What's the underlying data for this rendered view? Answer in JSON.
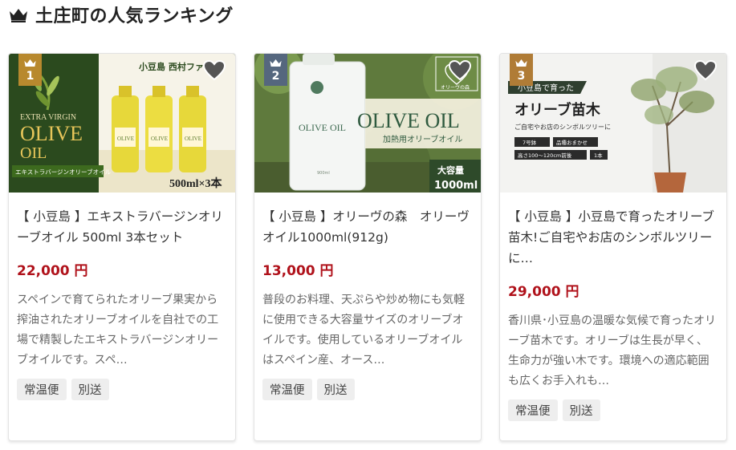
{
  "header": {
    "title": "土庄町の人気ランキング",
    "icon": "crown-icon"
  },
  "products": [
    {
      "rank": "1",
      "rank_color": "#b8892e",
      "title": "【 小豆島 】エキストラバージンオリーブオイル 500ml 3本セット",
      "price": "22,000 円",
      "description": "スペインで育てられたオリーブ果実から搾油されたオリーブオイルを自社での工場で精製したエキストラバージンオリーブオイルです。スペ…",
      "tags": [
        "常温便",
        "別送"
      ],
      "image_text": {
        "brand": "小豆島 西村ファ",
        "extra": "EXTRA VIRGIN",
        "olive": "OLIVE",
        "oil": "OIL",
        "banner": "エキストラバージンオリーブオイル",
        "bottle_label": "OLIVE",
        "size": "500ml×3本"
      }
    },
    {
      "rank": "2",
      "rank_color": "#55677e",
      "title": "【 小豆島 】オリーヴの森　オリーヴオイル1000ml(912g)",
      "price": "13,000 円",
      "description": "普段のお料理、天ぷらや炒め物にも気軽に使用できる大容量サイズのオリーブオイルです。使用しているオリーブオイルはスペイン産、オース…",
      "tags": [
        "常温便",
        "別送"
      ],
      "image_text": {
        "can_label": "OLIVE OIL",
        "can_small": "900ml",
        "headline": "OLIVE OIL",
        "subtitle": "加熱用オリーブオイル",
        "badge_top": "大容量",
        "badge_bottom": "1000ml",
        "logo": "オリーヴの森"
      }
    },
    {
      "rank": "3",
      "rank_color": "#b07c36",
      "title": "【 小豆島 】小豆島で育ったオリーブ苗木!ご自宅やお店のシンボルツリーに…",
      "price": "29,000 円",
      "description": "香川県･小豆島の温暖な気候で育ったオリーブ苗木です。オリーブは生長が早く、生命力が強い木です。環境への適応範囲も広くお手入れも…",
      "tags": [
        "常温便",
        "別送"
      ],
      "image_text": {
        "ribbon": "小豆島で育った",
        "headline": "オリーブ苗木",
        "subtitle": "ご自宅やお店のシンボルツリーに",
        "spec1": "7号鉢",
        "spec2": "品種おまかせ",
        "spec3": "高さ100〜120cm前後",
        "spec4": "1本"
      }
    }
  ]
}
